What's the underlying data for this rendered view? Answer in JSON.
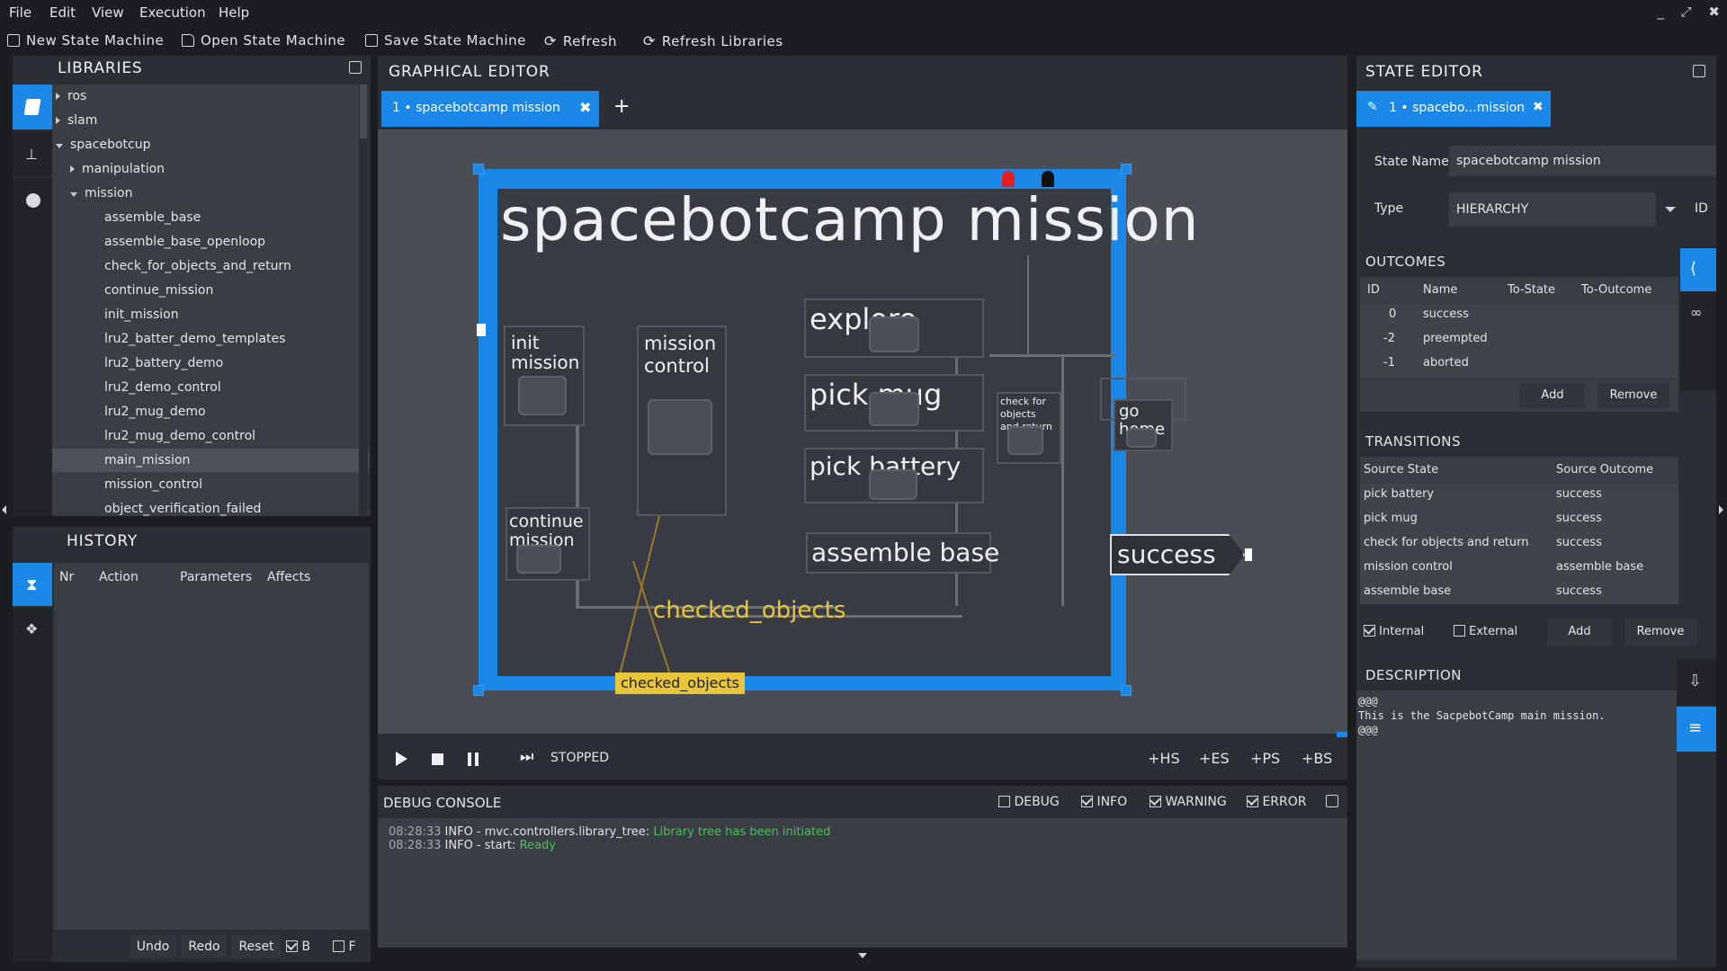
{
  "menu": [
    "File",
    "Edit",
    "View",
    "Execution",
    "Help"
  ],
  "window_controls": [
    "_",
    "⤢",
    "✖"
  ],
  "toolbar": {
    "new": "New State Machine",
    "open": "Open State Machine",
    "save": "Save State Machine",
    "refresh": "Refresh",
    "refresh_libs": "Refresh Libraries"
  },
  "libraries": {
    "title": "LIBRARIES",
    "items": [
      {
        "label": "ros",
        "level": 0,
        "expand": "collapsed"
      },
      {
        "label": "slam",
        "level": 0,
        "expand": "collapsed"
      },
      {
        "label": "spacebotcup",
        "level": 0,
        "expand": "expanded"
      },
      {
        "label": "manipulation",
        "level": 1,
        "expand": "collapsed"
      },
      {
        "label": "mission",
        "level": 1,
        "expand": "expanded"
      },
      {
        "label": "assemble_base",
        "level": 2
      },
      {
        "label": "assemble_base_openloop",
        "level": 2
      },
      {
        "label": "check_for_objects_and_return",
        "level": 2
      },
      {
        "label": "continue_mission",
        "level": 2
      },
      {
        "label": "init_mission",
        "level": 2
      },
      {
        "label": "lru2_batter_demo_templates",
        "level": 2
      },
      {
        "label": "lru2_battery_demo",
        "level": 2
      },
      {
        "label": "lru2_demo_control",
        "level": 2
      },
      {
        "label": "lru2_mug_demo",
        "level": 2
      },
      {
        "label": "lru2_mug_demo_control",
        "level": 2
      },
      {
        "label": "main_mission",
        "level": 2,
        "selected": true
      },
      {
        "label": "mission_control",
        "level": 2
      },
      {
        "label": "object_verification_failed",
        "level": 2
      }
    ]
  },
  "history": {
    "title": "HISTORY",
    "columns": [
      "Nr",
      "Action",
      "Parameters",
      "Affects"
    ],
    "undo": "Undo",
    "redo": "Redo",
    "reset": "Reset",
    "b": "B",
    "f": "F"
  },
  "graphical_editor": {
    "title": "GRAPHICAL EDITOR",
    "tab": "1 • spacebotcamp mission",
    "add_tab": "+",
    "root_state": "spacebotcamp mission",
    "states": {
      "init": "init\nmission",
      "mission_control": "mission\ncontrol",
      "explore": "explore",
      "pick_mug": "pick mug",
      "pick_battery": "pick battery",
      "assemble_base": "assemble base",
      "continue_mission": "continue\nmission",
      "check": "check for\nobjects\nand return",
      "go_home": "go\nhome",
      "success": "success"
    },
    "scoped_var": "checked_objects",
    "scoped_var_tag": "checked_objects",
    "exec_status": "STOPPED",
    "add_buttons": [
      "+HS",
      "+ES",
      "+PS",
      "+BS"
    ]
  },
  "debug": {
    "title": "DEBUG CONSOLE",
    "filters": [
      {
        "label": "DEBUG",
        "checked": false
      },
      {
        "label": "INFO",
        "checked": true
      },
      {
        "label": "WARNING",
        "checked": true
      },
      {
        "label": "ERROR",
        "checked": true
      }
    ],
    "lines": [
      {
        "time": "08:28:33",
        "prefix": "INFO - mvc.controllers.library_tree:",
        "msg": "Library tree has been initiated"
      },
      {
        "time": "08:28:33",
        "prefix": "INFO - start:",
        "msg": "Ready"
      }
    ]
  },
  "state_editor": {
    "title": "STATE EDITOR",
    "tab": "1 • spacebo...mission",
    "state_name_label": "State Name",
    "state_name": "spacebotcamp mission",
    "type_label": "Type",
    "type_value": "HIERARCHY",
    "id_label": "ID",
    "outcomes_title": "OUTCOMES",
    "outcome_columns": [
      "ID",
      "Name",
      "To-State",
      "To-Outcome"
    ],
    "outcomes": [
      {
        "id": "0",
        "name": "success"
      },
      {
        "id": "-2",
        "name": "preempted"
      },
      {
        "id": "-1",
        "name": "aborted"
      }
    ],
    "add": "Add",
    "remove": "Remove",
    "transitions_title": "TRANSITIONS",
    "transition_columns": [
      "Source State",
      "Source Outcome"
    ],
    "transitions": [
      {
        "src": "pick battery",
        "out": "success"
      },
      {
        "src": "pick mug",
        "out": "success"
      },
      {
        "src": "check for objects and return",
        "out": "success"
      },
      {
        "src": "mission control",
        "out": "assemble base"
      },
      {
        "src": "assemble base",
        "out": "success"
      }
    ],
    "internal": "Internal",
    "external": "External",
    "description_title": "DESCRIPTION",
    "description": [
      "@@@",
      "This is the SacpebotCamp main mission.",
      "@@@"
    ]
  },
  "colors": {
    "accent": "#1b87e6",
    "scoped": "#e8c53a",
    "log_green": "#4fbf5a"
  }
}
